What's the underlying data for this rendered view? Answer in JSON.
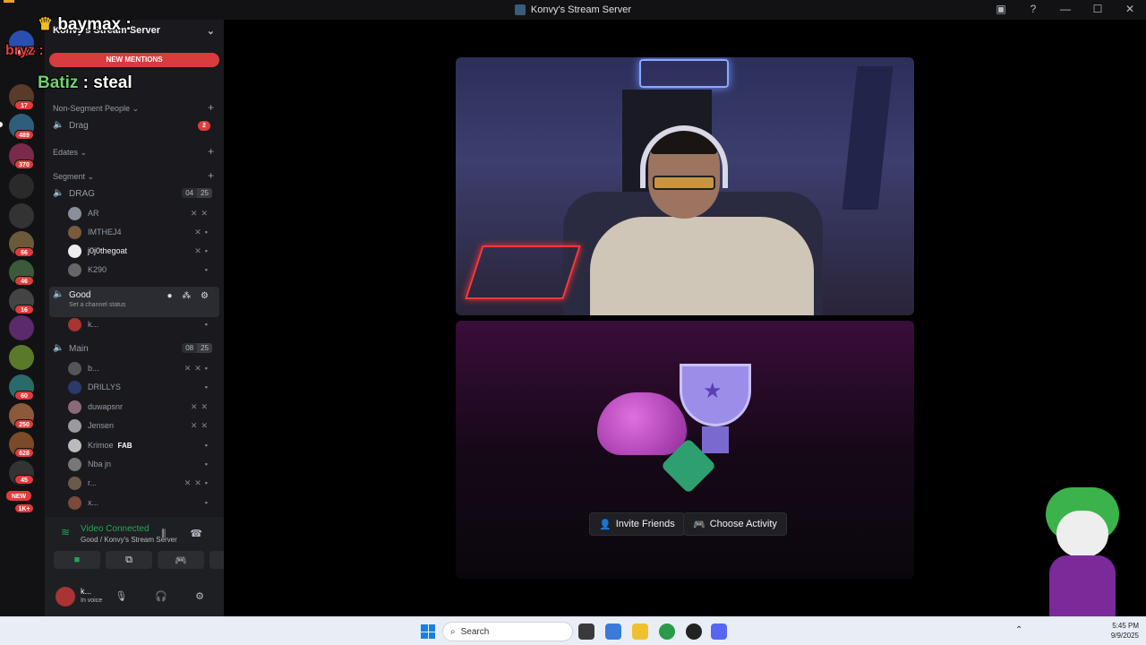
{
  "window": {
    "title": "Konvy's Stream Server"
  },
  "overlay_chat": [
    {
      "user": "baymax",
      "text": ""
    },
    {
      "user": "bryz",
      "text": ""
    },
    {
      "user": "Batiz",
      "text": "steal"
    }
  ],
  "server_rail": {
    "badges": [
      "NEW",
      "17",
      "489",
      "370",
      "66",
      "46",
      "16",
      "60",
      "250",
      "628",
      "45",
      "NEW",
      "1K+"
    ]
  },
  "server": {
    "name": "Konvy's Stream Server",
    "new_mentions": "NEW MENTIONS"
  },
  "categories": [
    {
      "label": "Non-Segment People",
      "chevron": "⌄"
    },
    {
      "label": "Edates",
      "chevron": "⌄"
    },
    {
      "label": "Segment",
      "chevron": "⌄"
    }
  ],
  "channels": {
    "drag_top": {
      "name": "Drag",
      "badge": "2"
    },
    "drag": {
      "name": "DRAG",
      "video_count": "04",
      "user_count": "25"
    },
    "drag_users": [
      "AR",
      "IMTHEJ4",
      "j0j0thegoat",
      "K290"
    ],
    "good": {
      "name": "Good",
      "status": "Set a channel status"
    },
    "good_users": [
      "k..."
    ],
    "main": {
      "name": "Main",
      "video_count": "08",
      "user_count": "25"
    },
    "main_users": [
      "b...",
      "DRILLYS",
      "duwapsnr",
      "Jensen",
      "Krimoe",
      "Nba jn",
      "r...",
      "x..."
    ],
    "krimoe_tag": "FAB"
  },
  "rtc": {
    "title": "Video Connected",
    "subtitle": "Good / Konvy's Stream Server"
  },
  "me": {
    "name": "k...",
    "status": "In voice"
  },
  "activity": {
    "invite_label": "Invite Friends",
    "choose_label": "Choose Activity"
  },
  "taskbar": {
    "search_label": "Search",
    "time": "5:45 PM",
    "date": "9/9/2025"
  }
}
